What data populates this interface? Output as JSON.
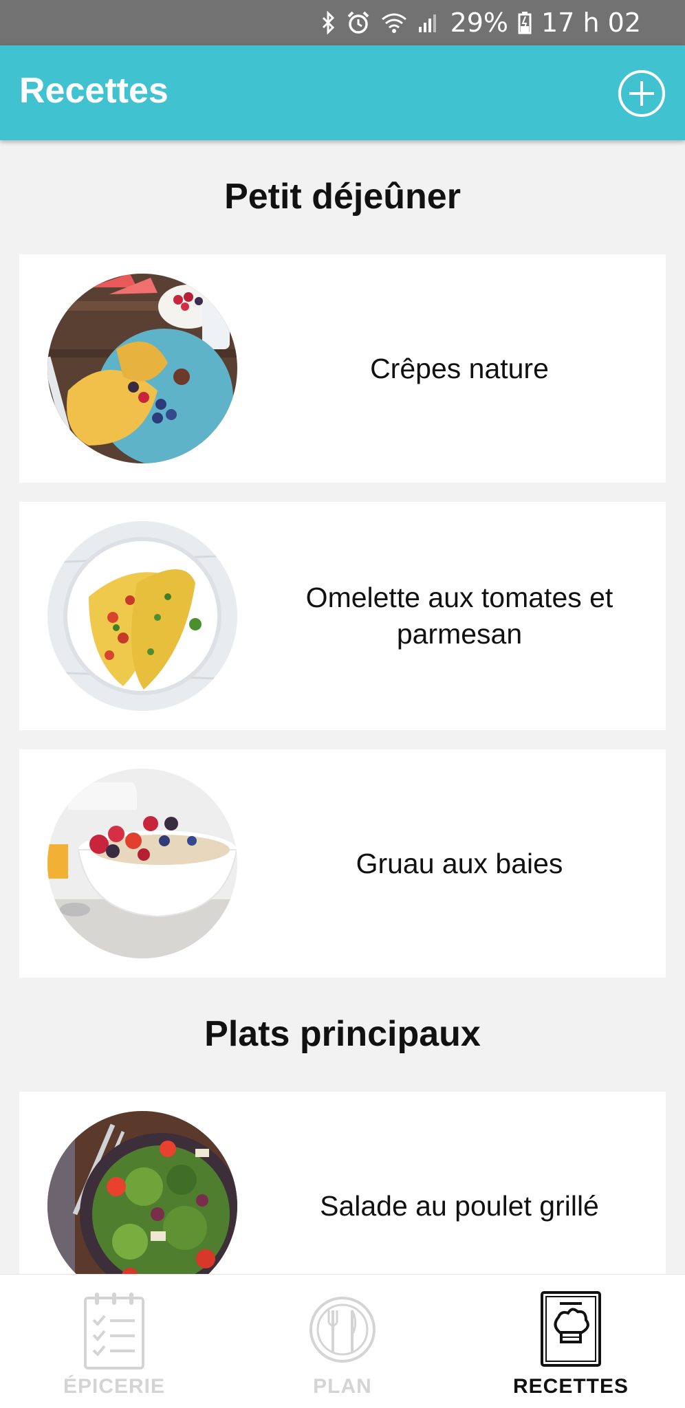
{
  "status_bar": {
    "battery": "29%",
    "time": "17 h 02"
  },
  "app_bar": {
    "title": "Recettes"
  },
  "sections": [
    {
      "title": "Petit déjeûner",
      "recipes": [
        {
          "name": "Crêpes nature"
        },
        {
          "name": "Omelette aux tomates et parmesan"
        },
        {
          "name": "Gruau aux baies"
        }
      ]
    },
    {
      "title": "Plats principaux",
      "recipes": [
        {
          "name": "Salade au poulet grillé"
        }
      ]
    }
  ],
  "bottom_nav": {
    "items": [
      {
        "label": "ÉPICERIE",
        "icon": "clipboard-checklist-icon",
        "active": false
      },
      {
        "label": "PLAN",
        "icon": "plate-fork-knife-icon",
        "active": false
      },
      {
        "label": "RECETTES",
        "icon": "cookbook-chef-hat-icon",
        "active": true
      }
    ]
  },
  "colors": {
    "accent": "#41c2d0",
    "status_bar": "#727272",
    "inactive_nav": "#d4d4d4"
  }
}
